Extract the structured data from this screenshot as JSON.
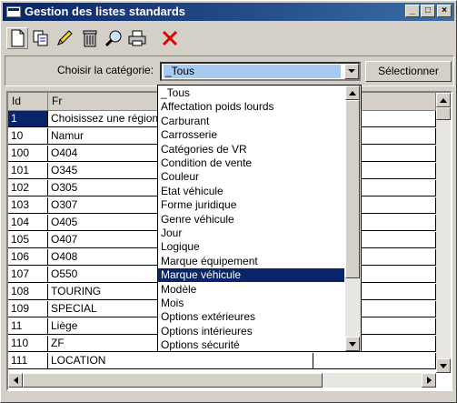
{
  "window": {
    "title": "Gestion des listes standards"
  },
  "toolbar": {
    "tools": [
      "new-icon",
      "copy-icon",
      "edit-icon",
      "delete-icon",
      "search-icon",
      "print-icon",
      "close-red-icon"
    ]
  },
  "filter": {
    "label": "Choisir la catégorie:",
    "selected_value": "_Tous",
    "select_button": "Sélectionner"
  },
  "grid": {
    "columns": [
      "Id",
      "Fr"
    ],
    "rows": [
      {
        "id": "1",
        "fr": "Choisissez une région"
      },
      {
        "id": "10",
        "fr": "Namur"
      },
      {
        "id": "100",
        "fr": "O404"
      },
      {
        "id": "101",
        "fr": "O345"
      },
      {
        "id": "102",
        "fr": "O305"
      },
      {
        "id": "103",
        "fr": "O307"
      },
      {
        "id": "104",
        "fr": "O405"
      },
      {
        "id": "105",
        "fr": "O407"
      },
      {
        "id": "106",
        "fr": "O408"
      },
      {
        "id": "107",
        "fr": "O550"
      },
      {
        "id": "108",
        "fr": "TOURING"
      },
      {
        "id": "109",
        "fr": "SPECIAL"
      },
      {
        "id": "11",
        "fr": "Liège"
      },
      {
        "id": "110",
        "fr": "ZF"
      },
      {
        "id": "111",
        "fr": "LOCATION"
      }
    ],
    "selected_row": 0
  },
  "dropdown": {
    "options": [
      "_Tous",
      "Affectation poids lourds",
      "Carburant",
      "Carrosserie",
      "Catégories de VR",
      "Condition de vente",
      "Couleur",
      "Etat véhicule",
      "Forme juridique",
      "Genre véhicule",
      "Jour",
      "Logique",
      "Marque équipement",
      "Marque véhicule",
      "Modèle",
      "Mois",
      "Options extérieures",
      "Options intérieures",
      "Options sécurité"
    ],
    "highlighted": "Marque véhicule"
  },
  "colors": {
    "title_start": "#0a246a",
    "title_end": "#3a6ea5",
    "highlight": "#0a246a",
    "combo_value_bg": "#a6caf0"
  }
}
